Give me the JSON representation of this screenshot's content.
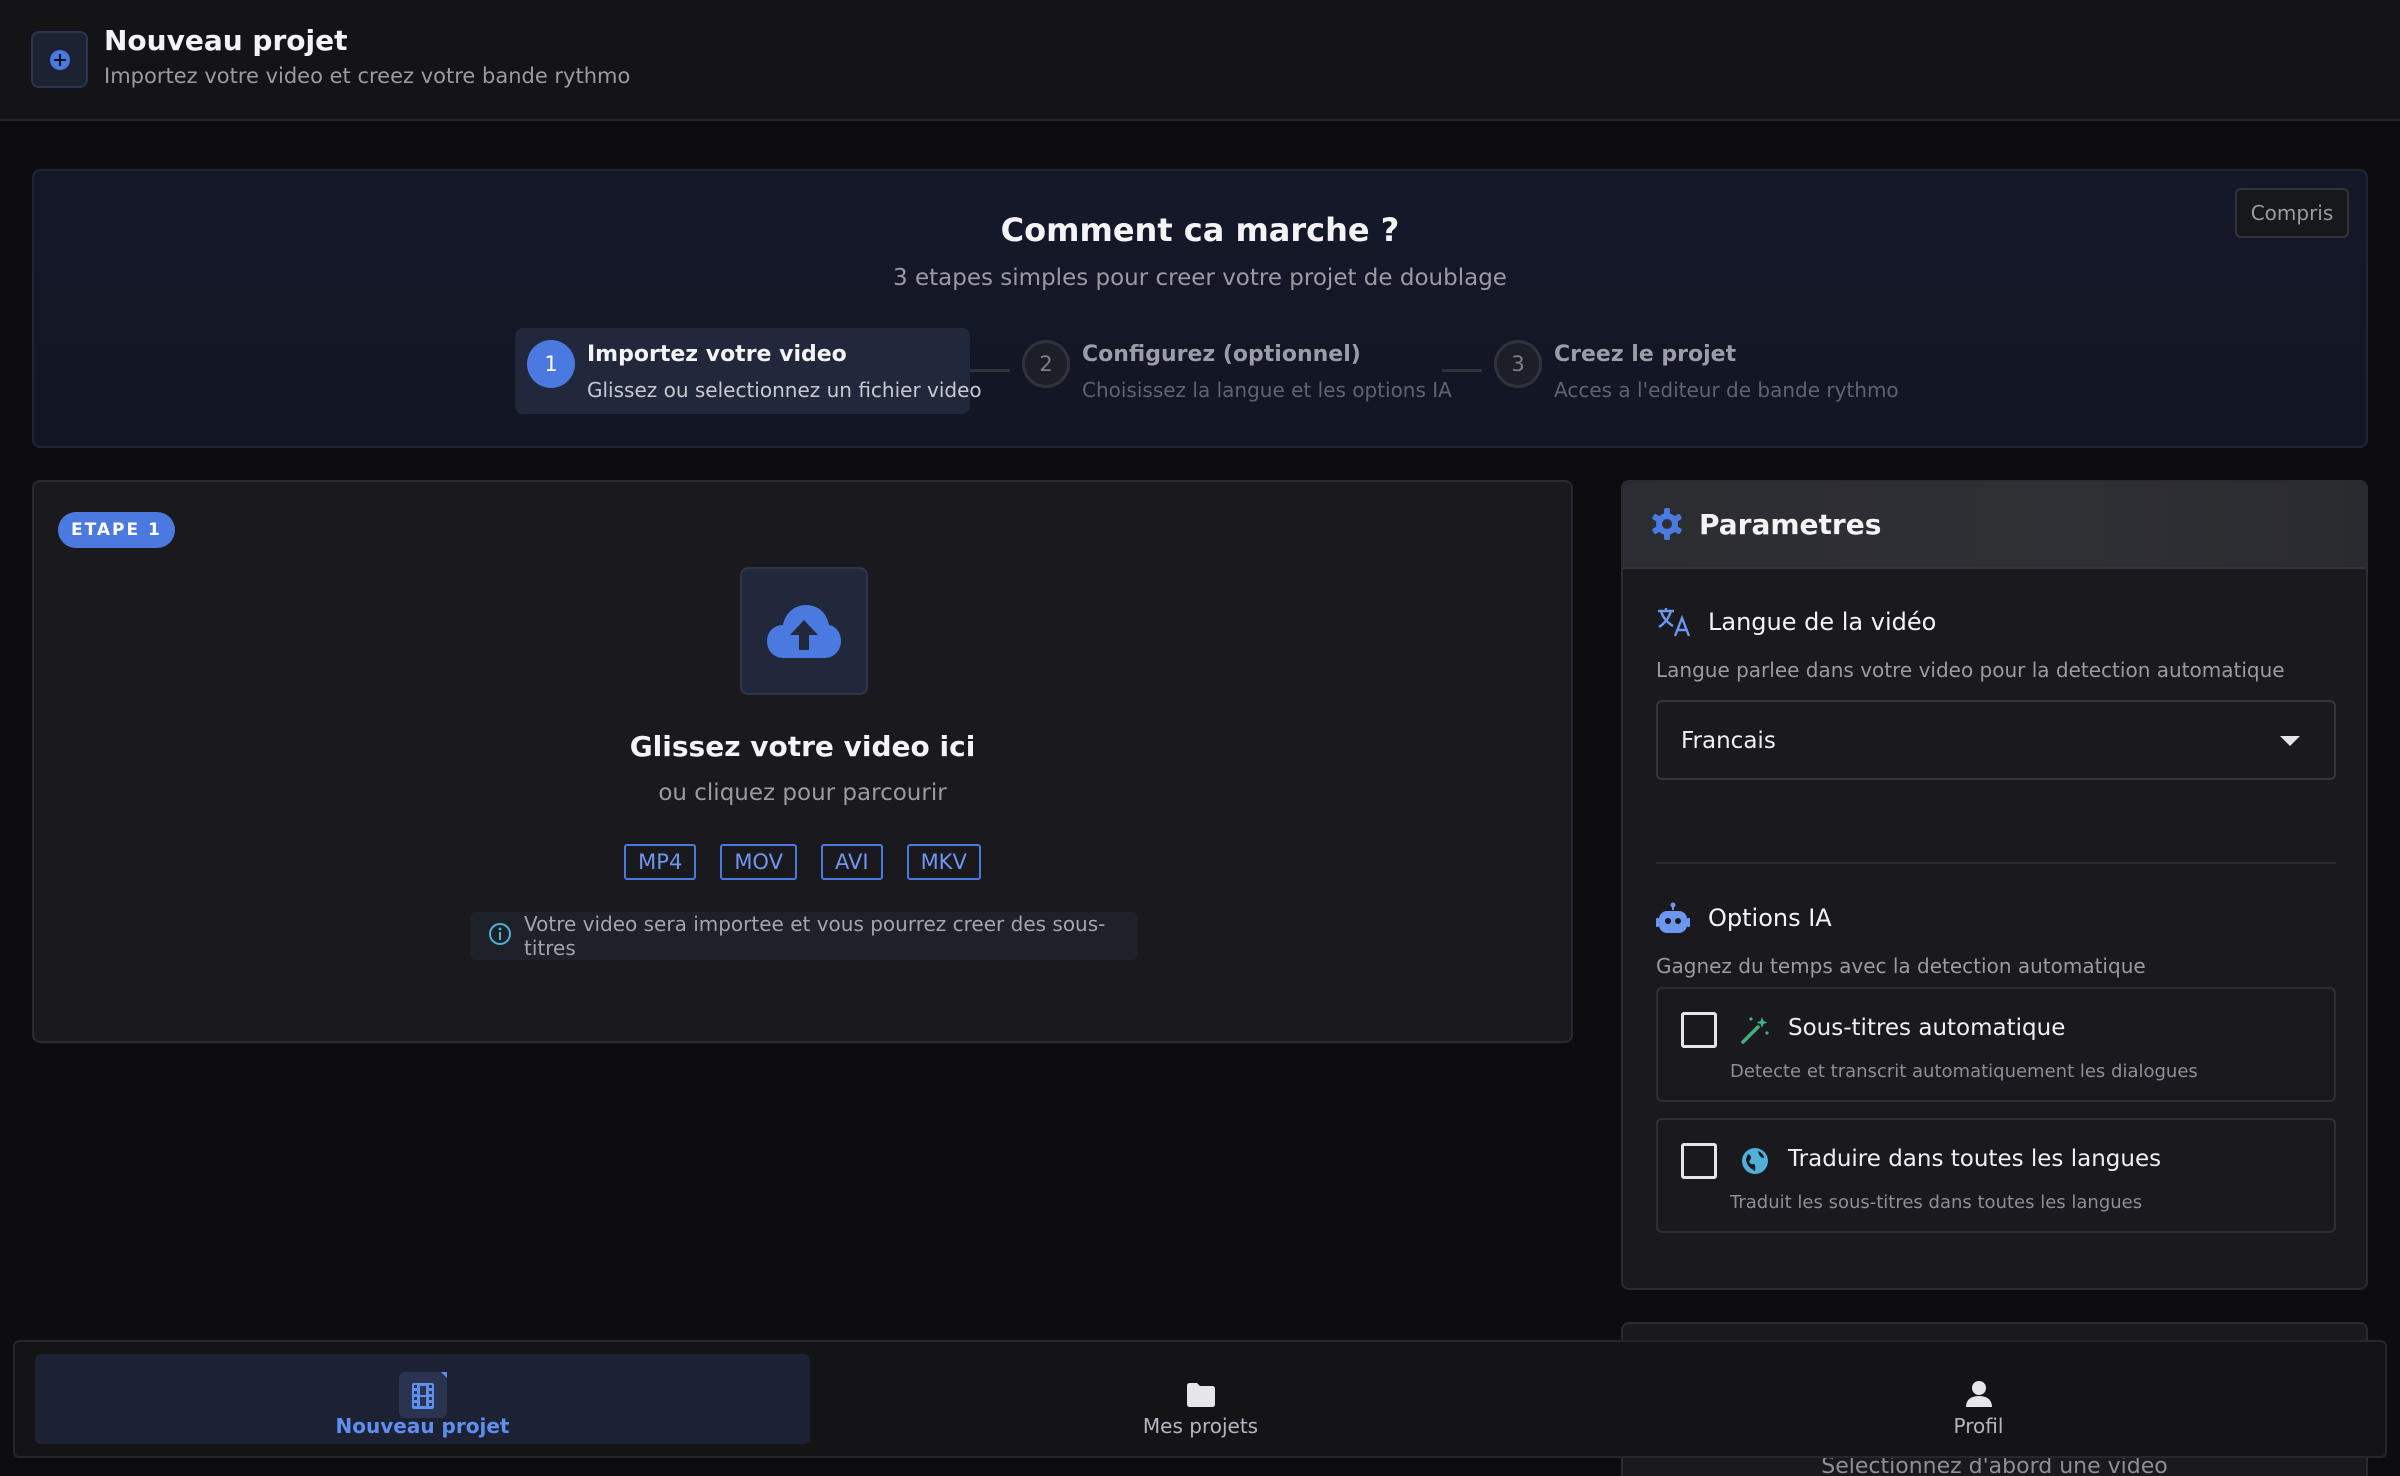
{
  "header": {
    "title": "Nouveau projet",
    "subtitle": "Importez votre video et creez votre bande rythmo"
  },
  "howto": {
    "heading": "Comment ca marche ?",
    "subtitle": "3 etapes simples pour creer votre projet de doublage",
    "dismiss_label": "Compris",
    "steps": [
      {
        "num": "1",
        "title": "Importez votre video",
        "desc": "Glissez ou selectionnez un fichier video",
        "active": true
      },
      {
        "num": "2",
        "title": "Configurez (optionnel)",
        "desc": "Choisissez la langue et les options IA",
        "active": false
      },
      {
        "num": "3",
        "title": "Creez le projet",
        "desc": "Acces a l'editeur de bande rythmo",
        "active": false
      }
    ]
  },
  "upload": {
    "badge": "ETAPE 1",
    "title": "Glissez votre video ici",
    "subtitle": "ou cliquez pour parcourir",
    "formats": [
      "MP4",
      "MOV",
      "AVI",
      "MKV"
    ],
    "info": "Votre video sera importee et vous pourrez creer des sous-titres"
  },
  "settings": {
    "title": "Parametres",
    "language": {
      "title": "Langue de la vidéo",
      "desc": "Langue parlee dans votre video pour la detection automatique",
      "selected": "Francais"
    },
    "ai": {
      "title": "Options IA",
      "desc": "Gagnez du temps avec la detection automatique",
      "options": [
        {
          "title": "Sous-titres automatique",
          "desc": "Detecte et transcrit automatiquement les dialogues",
          "checked": false
        },
        {
          "title": "Traduire dans toutes les langues",
          "desc": "Traduit les sous-titres dans toutes les langues",
          "checked": false
        }
      ]
    }
  },
  "peek": {
    "text": "Selectionnez d'abord une video"
  },
  "nav": {
    "items": [
      {
        "label": "Nouveau projet",
        "icon": "film-icon",
        "active": true
      },
      {
        "label": "Mes projets",
        "icon": "folder-icon",
        "active": false
      },
      {
        "label": "Profil",
        "icon": "person-icon",
        "active": false
      }
    ]
  },
  "colors": {
    "accent": "#4a7ae0",
    "background": "#0d0d0f",
    "card": "#1a1a1e"
  }
}
